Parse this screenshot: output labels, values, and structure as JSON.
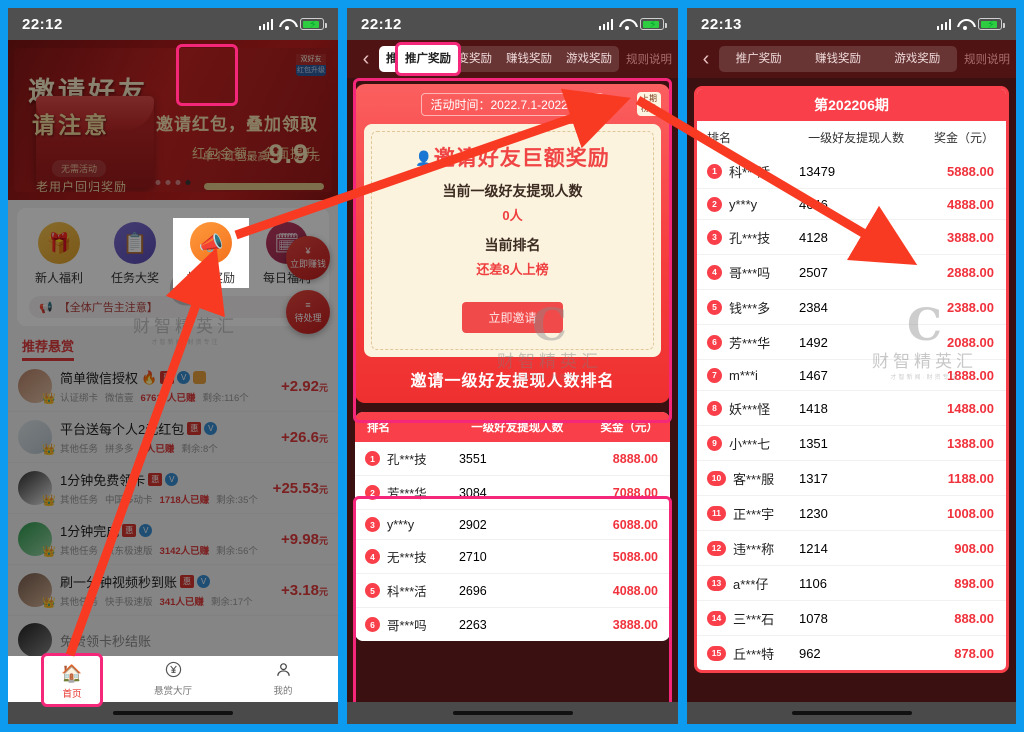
{
  "panels": [
    {
      "status": {
        "time": "22:12"
      },
      "banner": {
        "headline": "邀请好友",
        "sub_headline": "请注意",
        "pill": "无需活动",
        "old_user": "老用户回归奖励",
        "right1": "邀请红包，叠加领取",
        "right2": "红包金额，全面提升",
        "right3_prefix": "单个红包最高",
        "right3_value": "9.9",
        "right3_unit": "元",
        "badge_top": "双好友",
        "badge_bottom": "红包升级"
      },
      "quick_actions": [
        {
          "label": "新人福利",
          "icon": "gift-icon",
          "glyph": "🎁"
        },
        {
          "label": "任务大奖",
          "icon": "clipboard-icon",
          "glyph": "📋"
        },
        {
          "label": "推广奖励",
          "icon": "megaphone-icon",
          "glyph": "📣"
        },
        {
          "label": "每日福利",
          "icon": "calendar-check-icon",
          "glyph": "🗓"
        }
      ],
      "notice": "【全体广告主注意】",
      "recommend_title": "推荐悬赏",
      "tasks": [
        {
          "name": "简单微信授权",
          "cat": "认证绑卡",
          "source": "微信壹",
          "joined": "67618人已赚",
          "left": "剩余:116个",
          "amount": "2.92",
          "unit": "元"
        },
        {
          "name": "平台送每个人2元红包",
          "cat": "其他任务",
          "source": "拼多多",
          "joined": "1人已赚",
          "left": "剩余:8个",
          "amount": "26.6",
          "unit": "元"
        },
        {
          "name": "1分钟免费领卡",
          "cat": "其他任务",
          "source": "中国移动卡",
          "joined": "1718人已赚",
          "left": "剩余:35个",
          "amount": "25.53",
          "unit": "元"
        },
        {
          "name": "1分钟完成",
          "cat": "其他任务",
          "source": "京东极速版",
          "joined": "3142人已赚",
          "left": "剩余:56个",
          "amount": "9.98",
          "unit": "元"
        },
        {
          "name": "刷一分钟视频秒到账",
          "cat": "其他任务",
          "source": "快手极速版",
          "joined": "341人已赚",
          "left": "剩余:17个",
          "amount": "3.18",
          "unit": "元"
        }
      ],
      "float_buttons": [
        {
          "glyph": "¥",
          "label": "立即赚钱"
        },
        {
          "glyph": "≡",
          "label": "待处理"
        }
      ],
      "tabbar": [
        {
          "label": "首页",
          "icon": "home-icon",
          "glyph": "🏠",
          "active": true
        },
        {
          "label": "悬赏大厅",
          "icon": "yen-circle-icon",
          "glyph": "¥",
          "active": false
        },
        {
          "label": "我的",
          "icon": "person-icon",
          "glyph": "person",
          "active": false
        }
      ]
    },
    {
      "status": {
        "time": "22:12"
      },
      "nav": {
        "back_icon": "chevron-left-icon",
        "tabs": [
          {
            "label": "推广奖励",
            "active": true
          },
          {
            "label": "裂变奖励",
            "active": false
          },
          {
            "label": "赚钱奖励",
            "active": false
          },
          {
            "label": "游戏奖励",
            "active": false
          }
        ],
        "rules": "规则说明"
      },
      "promo": {
        "activity_time_label": "活动时间：",
        "activity_time_value": "2022.7.1-2022.7.31",
        "last_list_button": "上期榜单",
        "card_title": "邀请好友巨额奖励",
        "line1_label": "当前一级好友提现人数",
        "line1_value": "0人",
        "line2_label": "当前排名",
        "line2_value": "还差8人上榜",
        "invite_button": "立即邀请",
        "footer": "邀请一级好友提现人数排名"
      },
      "rank_table": {
        "headers": [
          "排名",
          "一级好友提现人数",
          "奖金（元）"
        ],
        "rows": [
          {
            "rank": "1",
            "name": "孔***技",
            "count": "3551",
            "prize": "8888.00"
          },
          {
            "rank": "2",
            "name": "芳***华",
            "count": "3084",
            "prize": "7088.00"
          },
          {
            "rank": "3",
            "name": "y***y",
            "count": "2902",
            "prize": "6088.00"
          },
          {
            "rank": "4",
            "name": "无***技",
            "count": "2710",
            "prize": "5088.00"
          },
          {
            "rank": "5",
            "name": "科***活",
            "count": "2696",
            "prize": "4088.00"
          },
          {
            "rank": "6",
            "name": "哥***吗",
            "count": "2263",
            "prize": "3888.00"
          }
        ]
      }
    },
    {
      "status": {
        "time": "22:13"
      },
      "nav": {
        "back_icon": "chevron-left-icon",
        "tabs": [
          {
            "label": "推广奖励",
            "active": false
          },
          {
            "label": "赚钱奖励",
            "active": false
          },
          {
            "label": "游戏奖励",
            "active": false
          }
        ],
        "rules": "规则说明"
      },
      "card": {
        "title": "第202206期",
        "headers": [
          "排名",
          "一级好友提现人数",
          "奖金（元）"
        ],
        "rows": [
          {
            "rank": "1",
            "name": "科***活",
            "count": "13479",
            "prize": "5888.00"
          },
          {
            "rank": "2",
            "name": "y***y",
            "count": "4646",
            "prize": "4888.00"
          },
          {
            "rank": "3",
            "name": "孔***技",
            "count": "4128",
            "prize": "3888.00"
          },
          {
            "rank": "4",
            "name": "哥***吗",
            "count": "2507",
            "prize": "2888.00"
          },
          {
            "rank": "5",
            "name": "钱***多",
            "count": "2384",
            "prize": "2388.00"
          },
          {
            "rank": "6",
            "name": "芳***华",
            "count": "1492",
            "prize": "2088.00"
          },
          {
            "rank": "7",
            "name": "m***i",
            "count": "1467",
            "prize": "1888.00"
          },
          {
            "rank": "8",
            "name": "妖***怪",
            "count": "1418",
            "prize": "1488.00"
          },
          {
            "rank": "9",
            "name": "小***七",
            "count": "1351",
            "prize": "1388.00"
          },
          {
            "rank": "10",
            "name": "客***服",
            "count": "1317",
            "prize": "1188.00"
          },
          {
            "rank": "11",
            "name": "正***宇",
            "count": "1230",
            "prize": "1008.00"
          },
          {
            "rank": "12",
            "name": "违***称",
            "count": "1214",
            "prize": "908.00"
          },
          {
            "rank": "13",
            "name": "a***仔",
            "count": "1106",
            "prize": "898.00"
          },
          {
            "rank": "14",
            "name": "三***石",
            "count": "1078",
            "prize": "888.00"
          },
          {
            "rank": "15",
            "name": "丘***特",
            "count": "962",
            "prize": "878.00"
          }
        ]
      }
    }
  ],
  "watermark": {
    "logo": "C",
    "text": "财智精英汇",
    "sub": "才智新闻·财资专注"
  },
  "colors": {
    "frame_blue": "#0d9bf0",
    "highlight_pink": "#f5277a",
    "arrow_red": "#f93a22",
    "brand_red": "#f9404a"
  }
}
